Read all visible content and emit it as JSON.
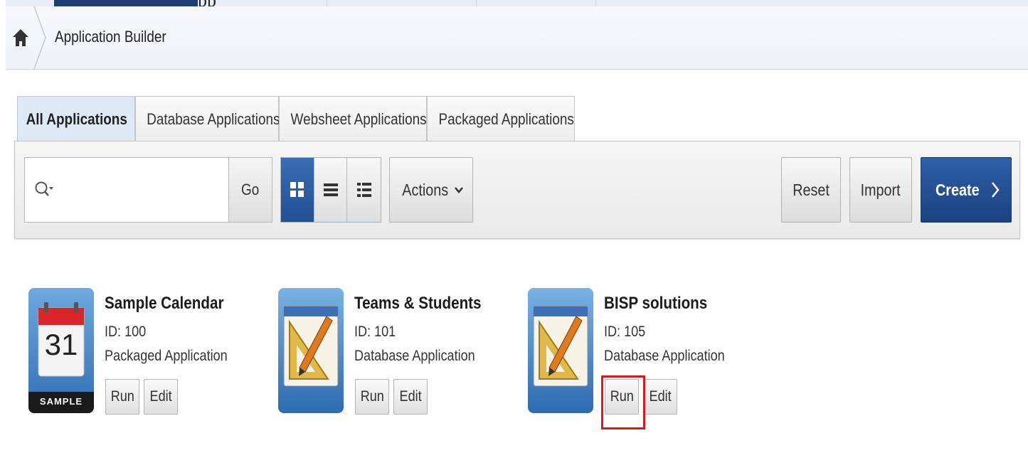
{
  "top_strip": {
    "cut_text": "pp"
  },
  "breadcrumb": {
    "home_icon": "home-icon",
    "title": "Application Builder"
  },
  "tabs": [
    {
      "label": "All Applications",
      "active": true
    },
    {
      "label": "Database Applications",
      "active": false
    },
    {
      "label": "Websheet Applications",
      "active": false
    },
    {
      "label": "Packaged Applications",
      "active": false
    }
  ],
  "toolbar": {
    "search_value": "",
    "search_icon": "search-icon",
    "go_label": "Go",
    "view_modes": [
      "icons-view",
      "report-view",
      "details-view"
    ],
    "active_view": "icons-view",
    "actions_label": "Actions",
    "reset_label": "Reset",
    "import_label": "Import",
    "create_label": "Create"
  },
  "applications": [
    {
      "name": "Sample Calendar",
      "id": "ID: 100",
      "type": "Packaged Application",
      "icon": "calendar-icon",
      "icon_day": "31",
      "icon_badge": "SAMPLE",
      "run_label": "Run",
      "edit_label": "Edit"
    },
    {
      "name": "Teams & Students",
      "id": "ID: 101",
      "type": "Database Application",
      "icon": "drafting-tools-icon",
      "run_label": "Run",
      "edit_label": "Edit"
    },
    {
      "name": "BISP solutions",
      "id": "ID: 105",
      "type": "Database Application",
      "icon": "drafting-tools-icon",
      "run_label": "Run",
      "edit_label": "Edit",
      "run_highlighted": true
    }
  ],
  "colors": {
    "accent": "#1f4a8a",
    "highlight": "#e0161b",
    "active_tab": "#dfe9f6"
  }
}
